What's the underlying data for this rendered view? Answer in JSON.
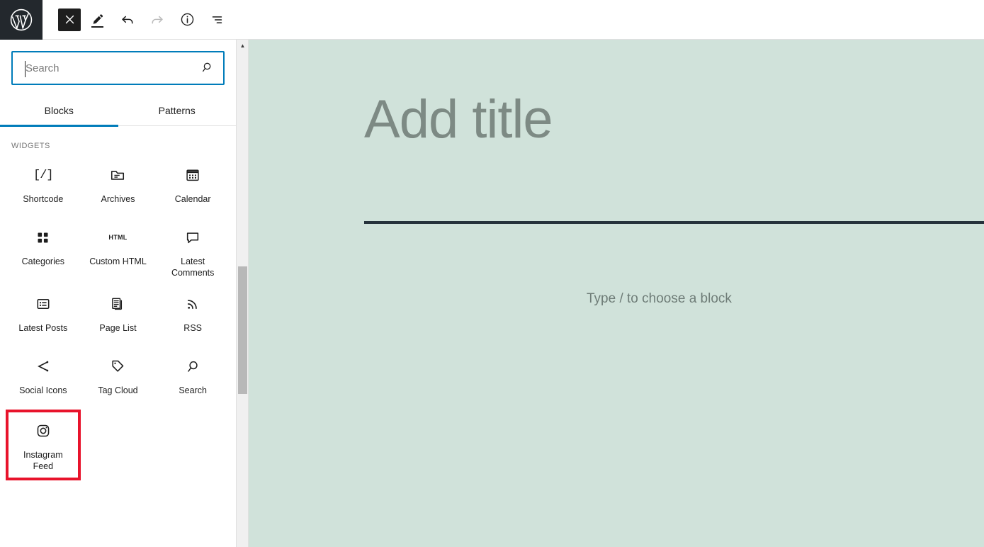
{
  "toolbar": {
    "logo_name": "wordpress-logo",
    "buttons": [
      {
        "name": "close-editor-button",
        "icon": "close-icon",
        "label": "Close"
      },
      {
        "name": "edit-mode-button",
        "icon": "pencil-icon",
        "label": "Edit"
      },
      {
        "name": "undo-button",
        "icon": "undo-icon",
        "label": "Undo"
      },
      {
        "name": "redo-button",
        "icon": "redo-icon",
        "label": "Redo",
        "disabled": true
      },
      {
        "name": "details-button",
        "icon": "info-icon",
        "label": "Details"
      },
      {
        "name": "list-view-button",
        "icon": "list-view-icon",
        "label": "List View"
      }
    ]
  },
  "inserter": {
    "search": {
      "value": "",
      "placeholder": "Search",
      "icon": "search-icon"
    },
    "tabs": [
      {
        "label": "Blocks",
        "active": true
      },
      {
        "label": "Patterns",
        "active": false
      }
    ],
    "section_title": "WIDGETS",
    "blocks": [
      {
        "label": "Shortcode",
        "icon": "shortcode-icon"
      },
      {
        "label": "Archives",
        "icon": "archives-folder-icon"
      },
      {
        "label": "Calendar",
        "icon": "calendar-icon"
      },
      {
        "label": "Categories",
        "icon": "categories-grid-icon"
      },
      {
        "label": "Custom HTML",
        "icon": "html-icon"
      },
      {
        "label": "Latest Comments",
        "icon": "comment-bubble-icon"
      },
      {
        "label": "Latest Posts",
        "icon": "latest-posts-icon"
      },
      {
        "label": "Page List",
        "icon": "page-list-icon"
      },
      {
        "label": "RSS",
        "icon": "rss-icon"
      },
      {
        "label": "Social Icons",
        "icon": "share-icon"
      },
      {
        "label": "Tag Cloud",
        "icon": "tag-icon"
      },
      {
        "label": "Search",
        "icon": "search-icon"
      },
      {
        "label": "Instagram Feed",
        "icon": "instagram-icon",
        "highlighted": true
      }
    ]
  },
  "scrollbar": {
    "up_arrow": "▲"
  },
  "canvas": {
    "title_placeholder": "Add title",
    "body_placeholder": "Type / to choose a block",
    "background_color": "#d0e2da",
    "rule_color": "#25323b",
    "placeholder_color": "#7d8a84"
  },
  "colors": {
    "accent": "#007cba",
    "highlight": "#e8132b",
    "toolbar_dark": "#23282d"
  }
}
